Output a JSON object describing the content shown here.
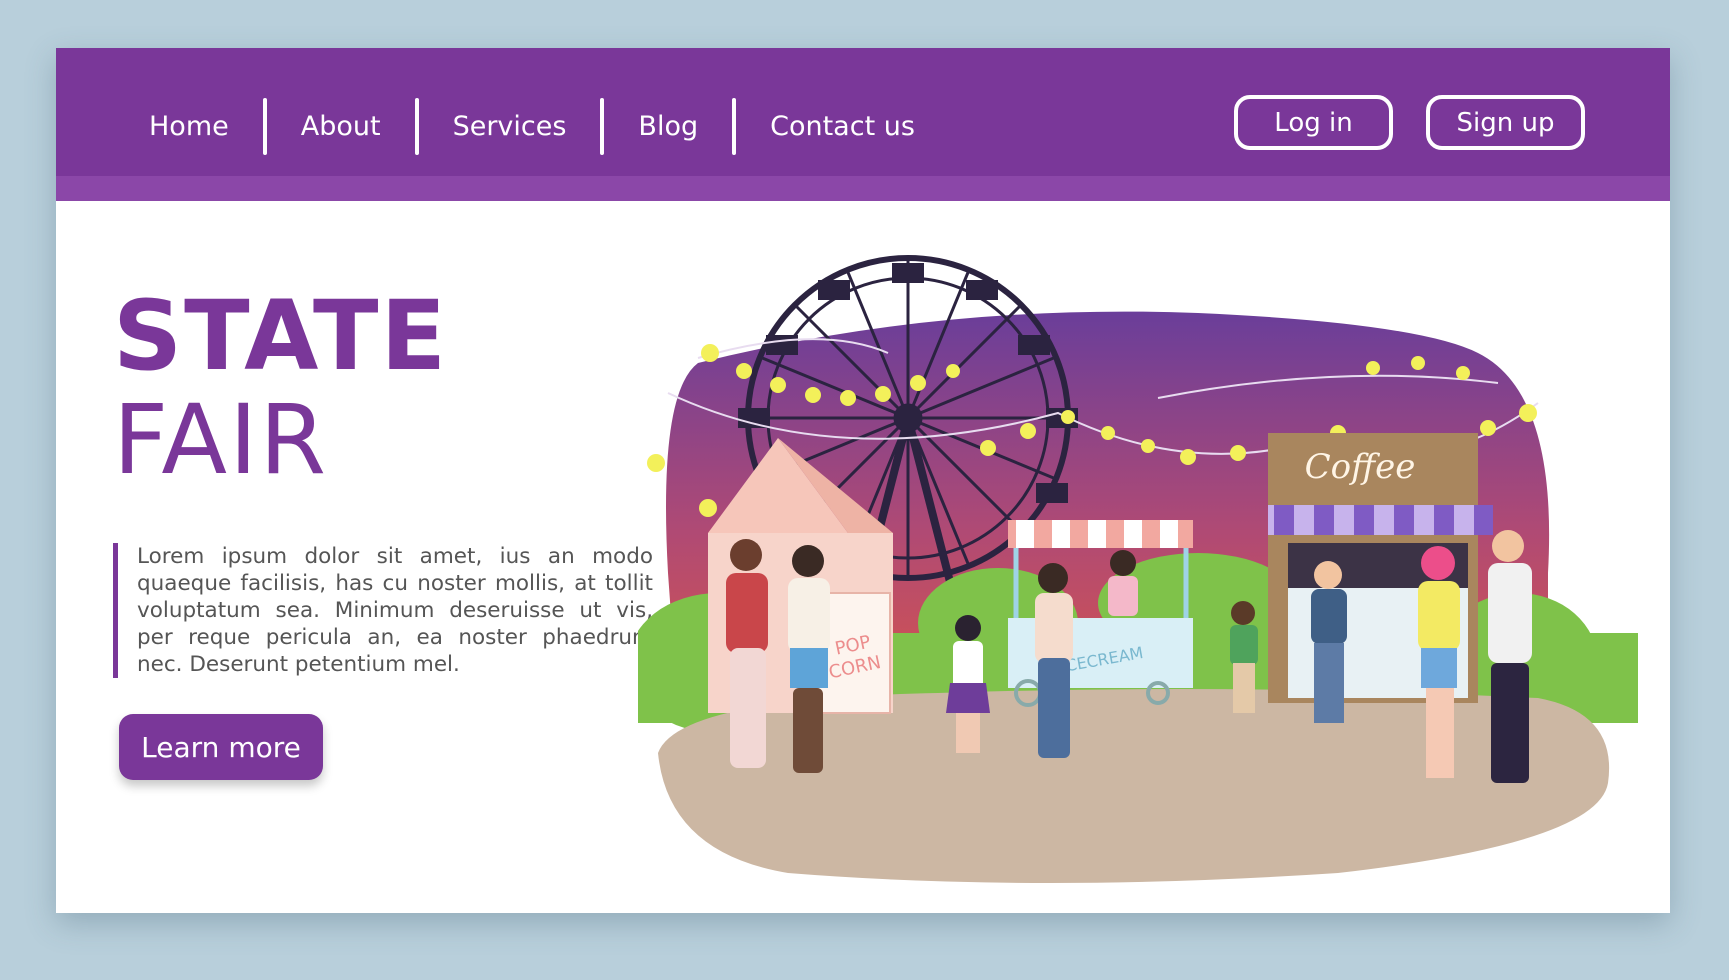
{
  "nav": {
    "links": [
      {
        "label": "Home"
      },
      {
        "label": "About"
      },
      {
        "label": "Services"
      },
      {
        "label": "Blog"
      },
      {
        "label": "Contact us"
      }
    ],
    "login_label": "Log in",
    "signup_label": "Sign up"
  },
  "hero": {
    "title_line1": "STATE",
    "title_line2": "FAIR",
    "description": "Lorem ipsum dolor sit amet, ius an modo quaeque facilisis, has cu noster mollis, at tollit voluptatum sea. Minimum deseruisse ut vis, per reque pericula an, ea noster phaedrum nec. Deserunt petentium mel.",
    "cta_label": "Learn more"
  },
  "illustration": {
    "booth_coffee": "Coffee",
    "booth_popcorn_line1": "POP",
    "booth_popcorn_line2": "CORN",
    "booth_icecream": "ICECREAM"
  },
  "colors": {
    "brand": "#7a3799",
    "background": "#b8cfdb",
    "sky_top": "#6a3e9a",
    "sky_bottom": "#d8544a"
  },
  "icons": [
    "ferris-wheel-icon",
    "string-lights-icon",
    "popcorn-tent-icon",
    "icecream-cart-icon",
    "coffee-stall-icon"
  ]
}
